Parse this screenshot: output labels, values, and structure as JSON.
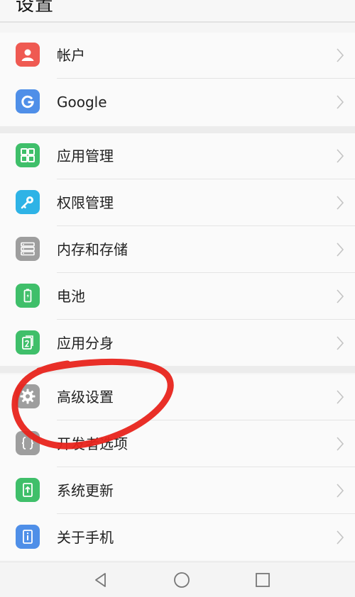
{
  "header": {
    "title": "设置"
  },
  "accounts": [
    {
      "label": "帐户",
      "icon": "account-icon",
      "color": "#ef5a52"
    },
    {
      "label": "Google",
      "icon": "google-icon",
      "color": "#4f8fe8"
    }
  ],
  "settings": [
    {
      "label": "应用管理",
      "icon": "app-manager-icon",
      "color": "#3fbf6a"
    },
    {
      "label": "权限管理",
      "icon": "key-icon",
      "color": "#2eb3e6"
    },
    {
      "label": "内存和存储",
      "icon": "storage-icon",
      "color": "#9e9e9e"
    },
    {
      "label": "电池",
      "icon": "battery-icon",
      "color": "#3fbf6a"
    },
    {
      "label": "应用分身",
      "icon": "app-twin-icon",
      "color": "#3fbf6a"
    }
  ],
  "system": [
    {
      "label": "高级设置",
      "icon": "gear-icon",
      "color": "#9e9e9e"
    },
    {
      "label": "开发者选项",
      "icon": "braces-icon",
      "color": "#9e9e9e"
    },
    {
      "label": "系统更新",
      "icon": "update-icon",
      "color": "#3fbf6a"
    },
    {
      "label": "关于手机",
      "icon": "info-icon",
      "color": "#4f8fe8"
    }
  ],
  "navbar": {
    "back": "back-icon",
    "home": "home-icon",
    "recents": "recents-icon"
  },
  "annotation_color": "#e8241c"
}
